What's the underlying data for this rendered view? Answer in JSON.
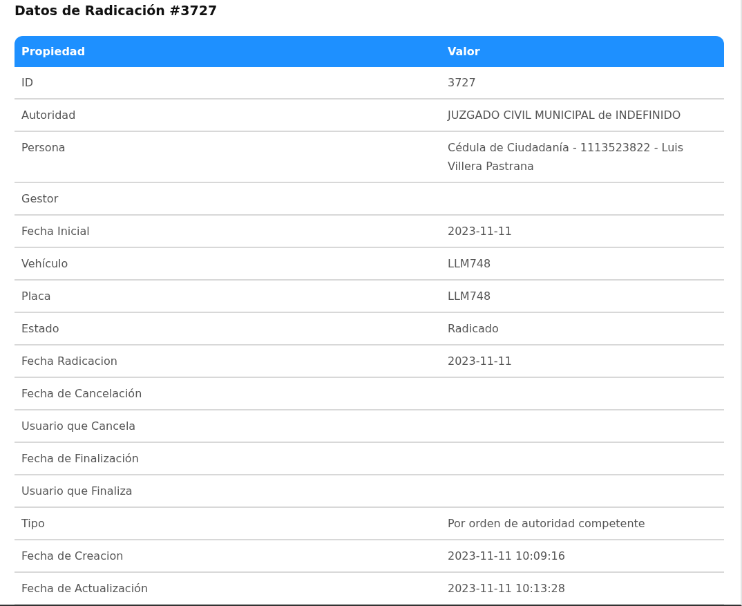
{
  "title": "Datos de Radicación #3727",
  "table": {
    "columns": [
      "Propiedad",
      "Valor"
    ],
    "rows": [
      {
        "property": "ID",
        "value": "3727"
      },
      {
        "property": "Autoridad",
        "value": "JUZGADO CIVIL MUNICIPAL de INDEFINIDO"
      },
      {
        "property": "Persona",
        "value": "Cédula de Ciudadanía - 1113523822 - Luis Villera Pastrana"
      },
      {
        "property": "Gestor",
        "value": ""
      },
      {
        "property": "Fecha Inicial",
        "value": "2023-11-11"
      },
      {
        "property": "Vehículo",
        "value": "LLM748"
      },
      {
        "property": "Placa",
        "value": "LLM748"
      },
      {
        "property": "Estado",
        "value": "Radicado"
      },
      {
        "property": "Fecha Radicacion",
        "value": "2023-11-11"
      },
      {
        "property": "Fecha de Cancelación",
        "value": ""
      },
      {
        "property": "Usuario que Cancela",
        "value": ""
      },
      {
        "property": "Fecha de Finalización",
        "value": ""
      },
      {
        "property": "Usuario que Finaliza",
        "value": ""
      },
      {
        "property": "Tipo",
        "value": "Por orden de autoridad competente"
      },
      {
        "property": "Fecha de Creacion",
        "value": "2023-11-11 10:09:16"
      },
      {
        "property": "Fecha de Actualización",
        "value": "2023-11-11 10:13:28"
      }
    ]
  }
}
